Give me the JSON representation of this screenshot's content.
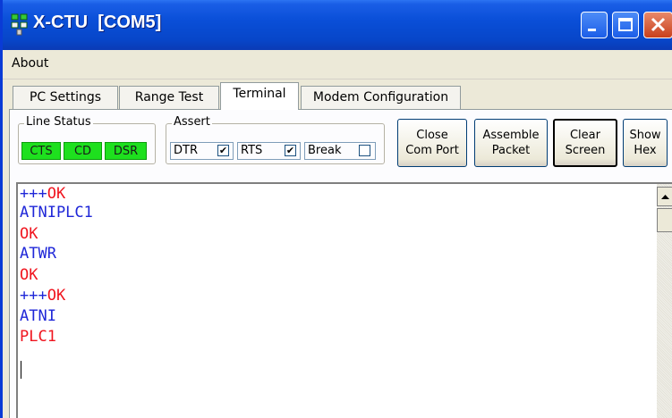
{
  "window": {
    "title": "X-CTU  [COM5]"
  },
  "menu": {
    "items": [
      "About"
    ]
  },
  "tabs": [
    "PC Settings",
    "Range Test",
    "Terminal",
    "Modem Configuration"
  ],
  "active_tab": "Terminal",
  "line_status": {
    "title": "Line Status",
    "indicators": [
      "CTS",
      "CD",
      "DSR"
    ],
    "indicator_color": "#1ee01e"
  },
  "assert": {
    "title": "Assert",
    "items": [
      {
        "label": "DTR",
        "checked": "✔"
      },
      {
        "label": "RTS",
        "checked": "✔"
      },
      {
        "label": "Break",
        "checked": ""
      }
    ]
  },
  "buttons": [
    {
      "line1": "Close",
      "line2": "Com Port"
    },
    {
      "line1": "Assemble",
      "line2": "Packet"
    },
    {
      "line1": "Clear",
      "line2": "Screen"
    },
    {
      "line1": "Show",
      "line2": "Hex"
    }
  ],
  "terminal": {
    "sent_color": "#1f27d8",
    "received_color": "#f0141e",
    "lines": [
      {
        "parts": [
          {
            "text": "+++",
            "dir": "sent"
          },
          {
            "text": "OK",
            "dir": "received"
          }
        ]
      },
      {
        "parts": [
          {
            "text": "ATNIPLC1",
            "dir": "sent"
          }
        ]
      },
      {
        "parts": [
          {
            "text": "OK",
            "dir": "received"
          }
        ]
      },
      {
        "parts": [
          {
            "text": "ATWR",
            "dir": "sent"
          }
        ]
      },
      {
        "parts": [
          {
            "text": "OK",
            "dir": "received"
          }
        ]
      },
      {
        "parts": [
          {
            "text": "+++",
            "dir": "sent"
          },
          {
            "text": "OK",
            "dir": "received"
          }
        ]
      },
      {
        "parts": [
          {
            "text": "ATNI",
            "dir": "sent"
          }
        ]
      },
      {
        "parts": [
          {
            "text": "PLC1",
            "dir": "received"
          }
        ]
      }
    ]
  }
}
